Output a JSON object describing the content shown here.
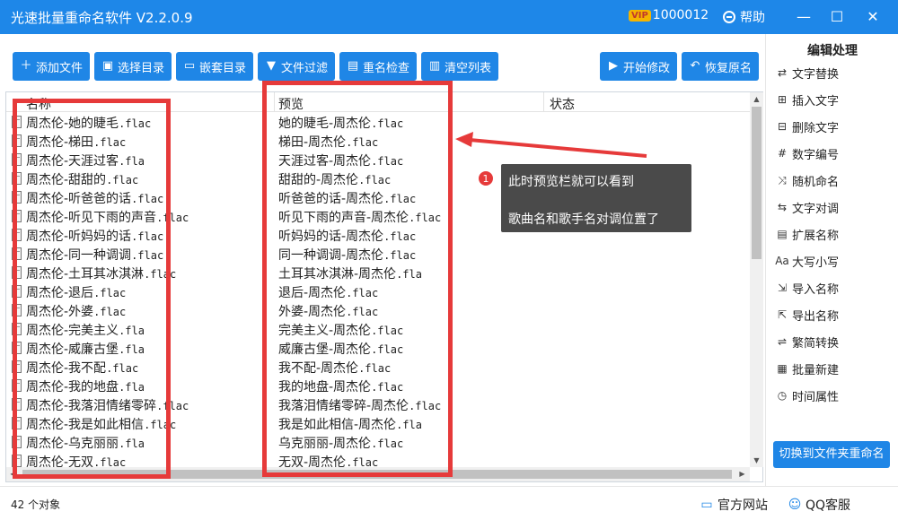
{
  "window": {
    "title": "光速批量重命名软件 V2.2.0.9",
    "vip_badge": "VIP",
    "user_id": "1000012",
    "help_label": "帮助",
    "minimize": "—",
    "maximize": "☐",
    "close": "✕"
  },
  "toolbar": {
    "add_file": "添加文件",
    "select_dir": "选择目录",
    "nested_dir": "嵌套目录",
    "file_filter": "文件过滤",
    "name_check": "重名检查",
    "clear_list": "清空列表",
    "start_modify": "开始修改",
    "restore_name": "恢复原名"
  },
  "list": {
    "col_name": "名称",
    "col_preview": "预览",
    "col_status": "状态",
    "rows": [
      {
        "name": "周杰伦-她的睫毛",
        "ext": ".flac",
        "preview": "她的睫毛-周杰伦",
        "pext": ".flac"
      },
      {
        "name": "周杰伦-梯田",
        "ext": ".flac",
        "preview": "梯田-周杰伦",
        "pext": ".flac"
      },
      {
        "name": "周杰伦-天涯过客",
        "ext": ".fla",
        "preview": "天涯过客-周杰伦",
        "pext": ".flac"
      },
      {
        "name": "周杰伦-甜甜的",
        "ext": ".flac",
        "preview": "甜甜的-周杰伦",
        "pext": ".flac"
      },
      {
        "name": "周杰伦-听爸爸的话",
        "ext": ".flac",
        "preview": "听爸爸的话-周杰伦",
        "pext": ".flac"
      },
      {
        "name": "周杰伦-听见下雨的声音",
        "ext": ".flac",
        "preview": "听见下雨的声音-周杰伦",
        "pext": ".flac"
      },
      {
        "name": "周杰伦-听妈妈的话",
        "ext": ".flac",
        "preview": "听妈妈的话-周杰伦",
        "pext": ".flac"
      },
      {
        "name": "周杰伦-同一种调调",
        "ext": ".flac",
        "preview": "同一种调调-周杰伦",
        "pext": ".flac"
      },
      {
        "name": "周杰伦-土耳其冰淇淋",
        "ext": ".flac",
        "preview": "土耳其冰淇淋-周杰伦",
        "pext": ".fla"
      },
      {
        "name": "周杰伦-退后",
        "ext": ".flac",
        "preview": "退后-周杰伦",
        "pext": ".flac"
      },
      {
        "name": "周杰伦-外婆",
        "ext": ".flac",
        "preview": "外婆-周杰伦",
        "pext": ".flac"
      },
      {
        "name": "周杰伦-完美主义",
        "ext": ".fla",
        "preview": "完美主义-周杰伦",
        "pext": ".flac"
      },
      {
        "name": "周杰伦-威廉古堡",
        "ext": ".fla",
        "preview": "威廉古堡-周杰伦",
        "pext": ".flac"
      },
      {
        "name": "周杰伦-我不配",
        "ext": ".flac",
        "preview": "我不配-周杰伦",
        "pext": ".flac"
      },
      {
        "name": "周杰伦-我的地盘",
        "ext": ".fla",
        "preview": "我的地盘-周杰伦",
        "pext": ".flac"
      },
      {
        "name": "周杰伦-我落泪情绪零碎",
        "ext": ".flac",
        "preview": "我落泪情绪零碎-周杰伦",
        "pext": ".flac"
      },
      {
        "name": "周杰伦-我是如此相信",
        "ext": ".flac",
        "preview": "我是如此相信-周杰伦",
        "pext": ".fla"
      },
      {
        "name": "周杰伦-乌克丽丽",
        "ext": ".fla",
        "preview": "乌克丽丽-周杰伦",
        "pext": ".flac"
      },
      {
        "name": "周杰伦-无双",
        "ext": ".flac",
        "preview": "无双-周杰伦",
        "pext": ".flac"
      }
    ]
  },
  "callout": {
    "number": "1",
    "line1": "此时预览栏就可以看到",
    "line2": "歌曲名和歌手名对调位置了"
  },
  "sidebar": {
    "title": "编辑处理",
    "items": [
      {
        "label": "文字替换",
        "icon": "⇄"
      },
      {
        "label": "插入文字",
        "icon": "⊞"
      },
      {
        "label": "删除文字",
        "icon": "⊟"
      },
      {
        "label": "数字编号",
        "icon": "#"
      },
      {
        "label": "随机命名",
        "icon": "⤨"
      },
      {
        "label": "文字对调",
        "icon": "⇆"
      },
      {
        "label": "扩展名称",
        "icon": "▤"
      },
      {
        "label": "大写小写",
        "icon": "Aa"
      },
      {
        "label": "导入名称",
        "icon": "⇲"
      },
      {
        "label": "导出名称",
        "icon": "⇱"
      },
      {
        "label": "繁简转换",
        "icon": "⇌"
      },
      {
        "label": "批量新建",
        "icon": "▦"
      },
      {
        "label": "时间属性",
        "icon": "◷"
      }
    ],
    "switch_button": "切换到文件夹重命名"
  },
  "status": {
    "count": "42 个对象",
    "website": "官方网站",
    "qq": "QQ客服"
  }
}
